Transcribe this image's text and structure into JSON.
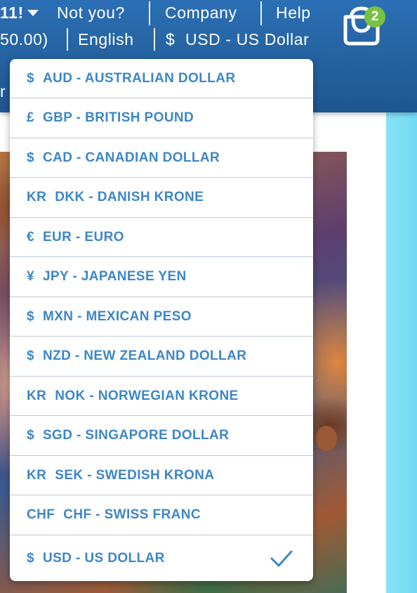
{
  "header": {
    "greeting_fragment": "11!",
    "not_you": "Not you?",
    "company": "Company",
    "help": "Help",
    "balance_fragment": "50.00)",
    "language": "English",
    "currency_symbol": "$",
    "currency": "USD - US Dollar",
    "cut_text": "r",
    "cart_count": "2"
  },
  "currency_menu": {
    "items": [
      {
        "symbol": "$",
        "label": "AUD - AUSTRALIAN DOLLAR"
      },
      {
        "symbol": "£",
        "label": "GBP - BRITISH POUND"
      },
      {
        "symbol": "$",
        "label": "CAD - CANADIAN DOLLAR"
      },
      {
        "symbol": "KR",
        "label": "DKK - DANISH KRONE"
      },
      {
        "symbol": "€",
        "label": "EUR - EURO"
      },
      {
        "symbol": "¥",
        "label": "JPY - JAPANESE YEN"
      },
      {
        "symbol": "$",
        "label": "MXN - MEXICAN PESO"
      },
      {
        "symbol": "$",
        "label": "NZD - NEW ZEALAND DOLLAR"
      },
      {
        "symbol": "KR",
        "label": "NOK - NORWEGIAN KRONE"
      },
      {
        "symbol": "$",
        "label": "SGD - SINGAPORE DOLLAR"
      },
      {
        "symbol": "KR",
        "label": "SEK - SWEDISH KRONA"
      },
      {
        "symbol": "CHF",
        "label": "CHF - SWISS FRANC"
      },
      {
        "symbol": "$",
        "label": "USD - US DOLLAR"
      }
    ],
    "selected_index": 12
  },
  "colors": {
    "header_blue": "#2566a8",
    "menu_text": "#3d86c6",
    "badge_green": "#7ac143",
    "accent_cyan": "#7fdff5"
  },
  "icons": {
    "caret": "caret-down-icon",
    "cart": "shopping-bag-icon",
    "check": "check-icon"
  }
}
